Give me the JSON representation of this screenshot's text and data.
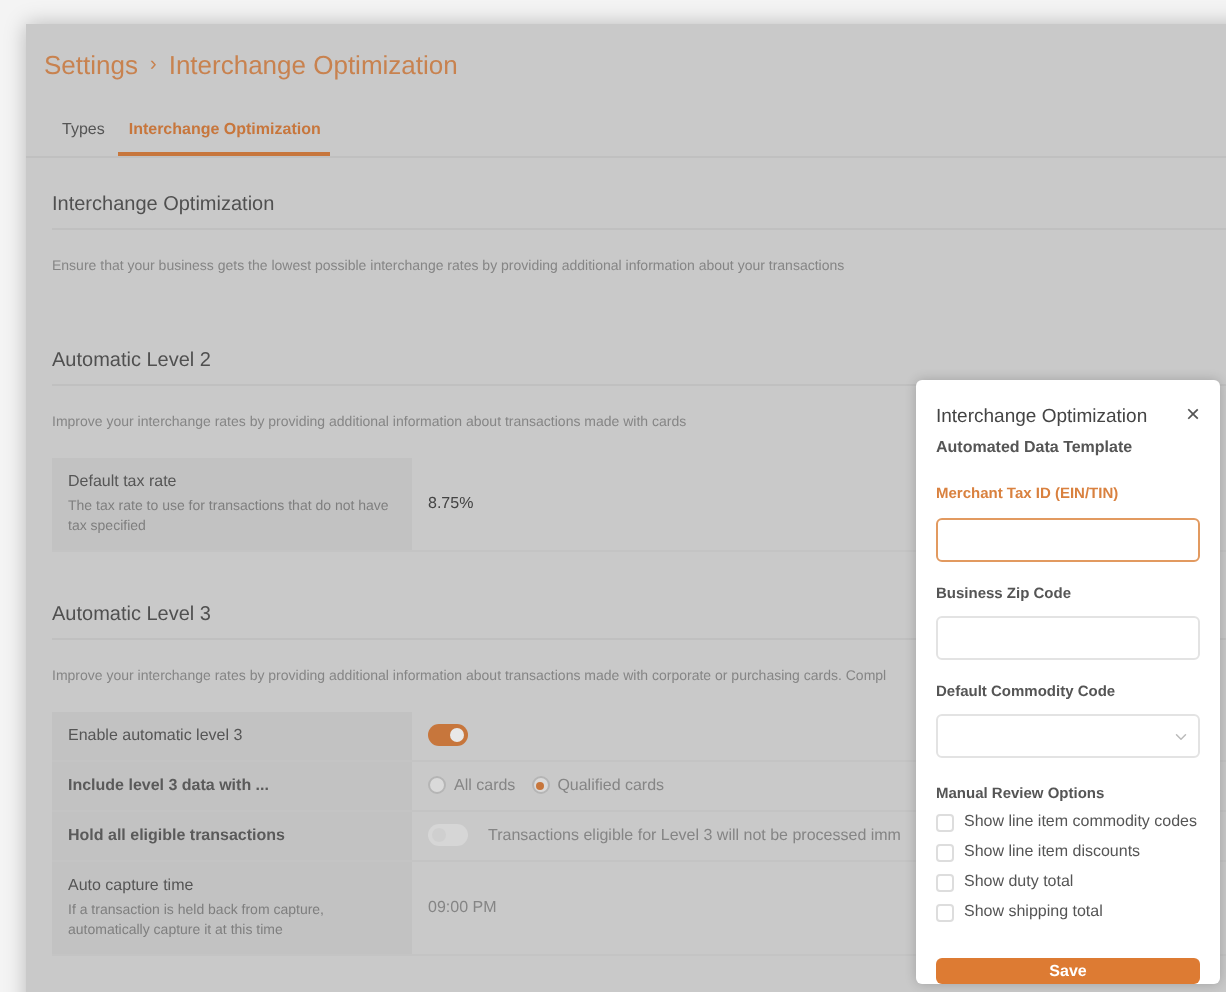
{
  "breadcrumb": {
    "items": [
      "Settings",
      "Interchange Optimization"
    ],
    "separator": "›"
  },
  "tabs": [
    {
      "label": "Types",
      "selected": false
    },
    {
      "label": "Interchange Optimization",
      "selected": true
    }
  ],
  "sections": [
    {
      "title": "Interchange Optimization",
      "description": "Ensure that your business gets the lowest possible interchange rates by providing additional information about your transactions"
    },
    {
      "title": "Automatic Level 2",
      "description": "Improve your interchange rates by providing additional information about transactions made with cards",
      "rows": [
        {
          "kind": "text",
          "label": "Default tax rate",
          "hint": "The tax rate to use for transactions that do not have tax specified",
          "value": "8.75%",
          "disabled": false
        }
      ]
    },
    {
      "title": "Automatic Level 3",
      "description": "Improve your interchange rates by providing additional information about transactions made with corporate or purchasing cards. Compl",
      "rows": [
        {
          "kind": "toggle",
          "label": "Enable automatic level 3",
          "on": true
        },
        {
          "kind": "radio",
          "label": "Include level 3 data with ...",
          "options": [
            {
              "label": "All cards",
              "selected": false
            },
            {
              "label": "Qualified cards",
              "selected": true
            }
          ]
        },
        {
          "kind": "toggle",
          "label": "Hold all eligible transactions",
          "on": false,
          "note": "Transactions eligible for Level 3 will not be processed imm"
        },
        {
          "kind": "text",
          "label": "Auto capture time",
          "hint": "If a transaction is held back from capture, automatically capture it at this time",
          "value": "09:00 PM",
          "disabled": true
        }
      ]
    }
  ],
  "dialog": {
    "title": "Interchange Optimization",
    "subtitle": "Automated Data Template",
    "close": "×",
    "fields": [
      {
        "label": "Merchant Tax ID (EIN/TIN)",
        "kind": "text",
        "focused": true
      },
      {
        "label": "Business Zip Code",
        "kind": "text",
        "focused": false
      },
      {
        "label": "Default Commodity Code",
        "kind": "select",
        "focused": false
      }
    ],
    "options_title": "Manual Review Options",
    "options": [
      {
        "label": "Show line item commodity codes",
        "checked": false
      },
      {
        "label": "Show line item discounts",
        "checked": false
      },
      {
        "label": "Show duty total",
        "checked": false
      },
      {
        "label": "Show shipping total",
        "checked": false
      }
    ],
    "save": "Save"
  }
}
